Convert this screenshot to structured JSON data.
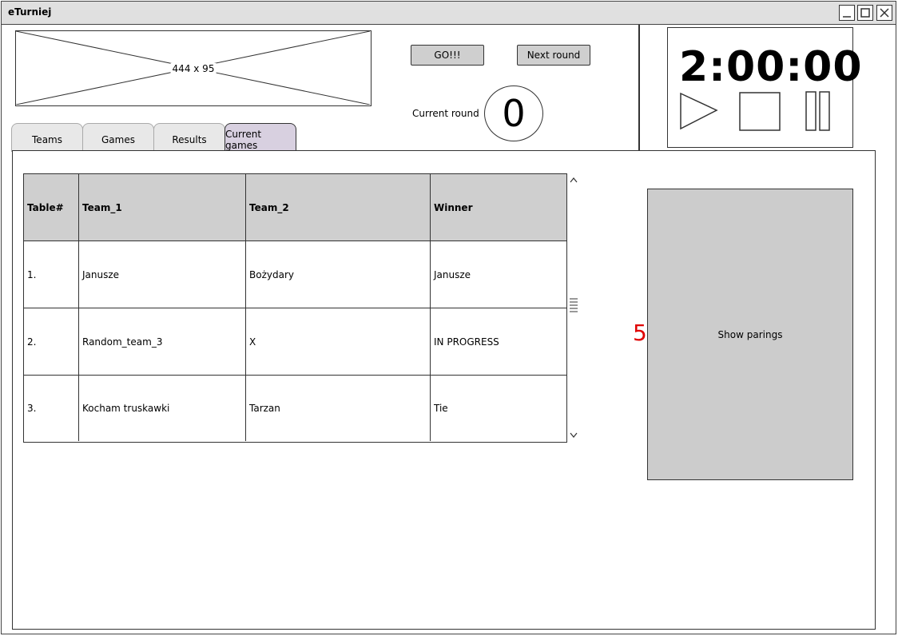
{
  "window": {
    "title": "eTurniej"
  },
  "header": {
    "image_placeholder_label": "444 x 95",
    "go_button": "GO!!!",
    "next_round_button": "Next round",
    "current_round_label": "Current round",
    "current_round_value": "0"
  },
  "timer": {
    "value": "2:00:00"
  },
  "tabs": [
    {
      "label": "Teams",
      "active": false
    },
    {
      "label": "Games",
      "active": false
    },
    {
      "label": "Results",
      "active": false
    },
    {
      "label": "Current games",
      "active": true
    }
  ],
  "games_table": {
    "columns": [
      "Table#",
      "Team_1",
      "Team_2",
      "Winner"
    ],
    "rows": [
      [
        "1.",
        "Janusze",
        "Bożydary",
        "Janusze"
      ],
      [
        "2.",
        "Random_team_3",
        "X",
        "IN PROGRESS"
      ],
      [
        "3.",
        "Kocham truskawki",
        "Tarzan",
        "Tie"
      ]
    ]
  },
  "side": {
    "marker": "5",
    "show_parings_button": "Show parings"
  },
  "icons": [
    "minimize-icon",
    "maximize-icon",
    "close-icon",
    "play-icon",
    "stop-icon",
    "pause-icon",
    "scroll-up-icon",
    "scroll-down-icon"
  ]
}
